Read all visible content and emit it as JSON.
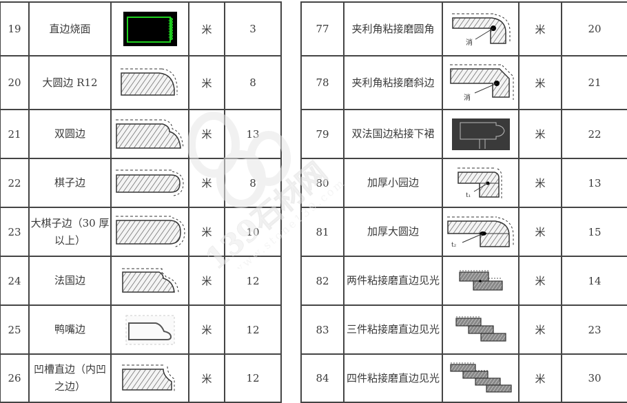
{
  "unit_label": "米",
  "left_table": {
    "rows": [
      {
        "no": "19",
        "name": "直边烧面",
        "unit": "米",
        "price": "3",
        "profile": "straight-flamed-edge-icon"
      },
      {
        "no": "20",
        "name": "大圆边 R12",
        "unit": "米",
        "price": "8",
        "profile": "large-round-edge-r12-icon"
      },
      {
        "no": "21",
        "name": "双圆边",
        "unit": "米",
        "price": "13",
        "profile": "double-round-edge-icon"
      },
      {
        "no": "22",
        "name": "棋子边",
        "unit": "米",
        "price": "8",
        "profile": "bullnose-edge-icon"
      },
      {
        "no": "23",
        "name": "大棋子边（30 厚以上）",
        "unit": "米",
        "price": "10",
        "profile": "large-bullnose-edge-icon"
      },
      {
        "no": "24",
        "name": "法国边",
        "unit": "米",
        "price": "12",
        "profile": "french-edge-icon"
      },
      {
        "no": "25",
        "name": "鸭嘴边",
        "unit": "米",
        "price": "12",
        "profile": "duckbill-edge-icon"
      },
      {
        "no": "26",
        "name": "凹槽直边（内凹之边）",
        "unit": "米",
        "price": "12",
        "profile": "grooved-straight-edge-icon"
      }
    ]
  },
  "right_table": {
    "rows": [
      {
        "no": "77",
        "name": "夹利角粘接磨圆角",
        "unit": "米",
        "price": "20",
        "profile": "mitered-rounded-corner-icon"
      },
      {
        "no": "78",
        "name": "夹利角粘接磨斜边",
        "unit": "米",
        "price": "21",
        "profile": "mitered-bevel-edge-icon"
      },
      {
        "no": "79",
        "name": "双法国边粘接下裙",
        "unit": "米",
        "price": "22",
        "profile": "double-french-edge-skirt-icon"
      },
      {
        "no": "80",
        "name": "加厚小园边",
        "unit": "米",
        "price": "13",
        "profile": "thickened-small-round-edge-icon"
      },
      {
        "no": "81",
        "name": "加厚大圆边",
        "unit": "米",
        "price": "15",
        "profile": "thickened-large-round-edge-icon"
      },
      {
        "no": "82",
        "name": "两件粘接磨直边见光",
        "unit": "米",
        "price": "14",
        "profile": "two-piece-laminated-edge-icon"
      },
      {
        "no": "83",
        "name": "三件粘接磨直边见光",
        "unit": "米",
        "price": "23",
        "profile": "three-piece-laminated-edge-icon"
      },
      {
        "no": "84",
        "name": "四件粘接磨直边见光",
        "unit": "米",
        "price": "30",
        "profile": "four-piece-laminated-edge-icon"
      }
    ]
  },
  "watermark": {
    "brand": "139石材网",
    "url": "www.stone139.com"
  }
}
